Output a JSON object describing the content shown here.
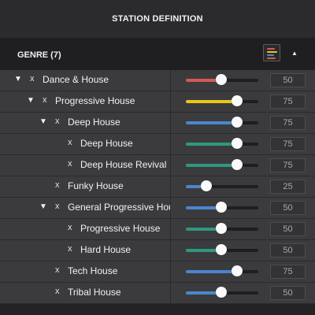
{
  "title": "STATION DEFINITION",
  "header": {
    "genre_label": "GENRE (7)",
    "color_button_icon": "color-bars-icon",
    "collapse_icon": "chevron-up-icon"
  },
  "colors": {
    "red": "#d15a56",
    "yellow": "#e6c917",
    "blue": "#4a86cd",
    "teal": "#2f9880"
  },
  "remove_glyph": "x",
  "expand_glyph": "▼",
  "items": [
    {
      "label": "Dance & House",
      "level": 0,
      "expandable": true,
      "value": "50",
      "fraction": 0.49,
      "color": "#d15a56"
    },
    {
      "label": "Progressive House",
      "level": 1,
      "expandable": true,
      "value": "75",
      "fraction": 0.71,
      "color": "#e6c917"
    },
    {
      "label": "Deep House",
      "level": 2,
      "expandable": true,
      "value": "75",
      "fraction": 0.71,
      "color": "#4a86cd"
    },
    {
      "label": "Deep House",
      "level": 3,
      "expandable": false,
      "value": "75",
      "fraction": 0.71,
      "color": "#2f9880"
    },
    {
      "label": "Deep House Revival",
      "level": 3,
      "expandable": false,
      "value": "75",
      "fraction": 0.71,
      "color": "#2f9880"
    },
    {
      "label": "Funky House",
      "level": 2,
      "expandable": false,
      "value": "25",
      "fraction": 0.28,
      "color": "#4a86cd"
    },
    {
      "label": "General Progressive House",
      "level": 2,
      "expandable": true,
      "value": "50",
      "fraction": 0.49,
      "color": "#4a86cd"
    },
    {
      "label": "Progressive House",
      "level": 3,
      "expandable": false,
      "value": "50",
      "fraction": 0.49,
      "color": "#2f9880"
    },
    {
      "label": "Hard House",
      "level": 3,
      "expandable": false,
      "value": "50",
      "fraction": 0.49,
      "color": "#2f9880"
    },
    {
      "label": "Tech House",
      "level": 2,
      "expandable": false,
      "value": "75",
      "fraction": 0.71,
      "color": "#4a86cd"
    },
    {
      "label": "Tribal House",
      "level": 2,
      "expandable": false,
      "value": "50",
      "fraction": 0.49,
      "color": "#4a86cd"
    }
  ]
}
